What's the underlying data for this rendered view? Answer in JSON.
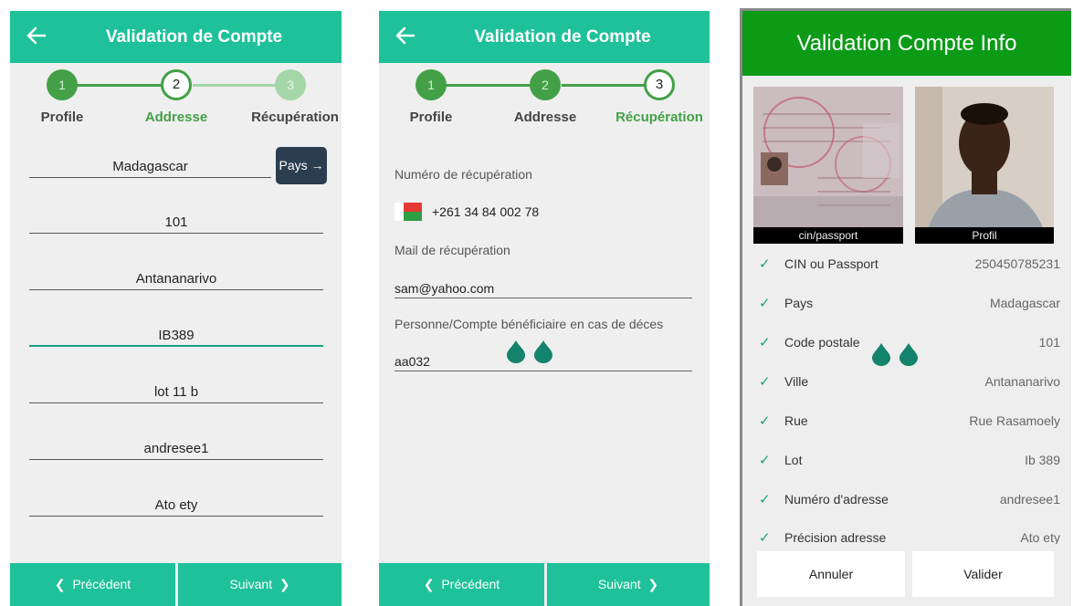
{
  "screen1": {
    "title": "Validation de Compte",
    "steps": [
      {
        "number": "1",
        "label": "Profile"
      },
      {
        "number": "2",
        "label": "Addresse"
      },
      {
        "number": "3",
        "label": "Récupération"
      }
    ],
    "country_value": "Madagascar",
    "pays_button": "Pays",
    "fields": [
      "101",
      "Antananarivo",
      "IB389",
      "lot 11 b",
      "andresee1",
      "Ato ety"
    ],
    "prev_label": "Précédent",
    "next_label": "Suivant"
  },
  "screen2": {
    "title": "Validation de Compte",
    "steps": [
      {
        "number": "1",
        "label": "Profile"
      },
      {
        "number": "2",
        "label": "Addresse"
      },
      {
        "number": "3",
        "label": "Récupération"
      }
    ],
    "phone_label": "Numéro de récupération",
    "phone_value": "+261 34 84 002 78",
    "mail_label": "Mail de récupération",
    "mail_value": "sam@yahoo.com",
    "beneficiary_label": "Personne/Compte bénéficiaire en cas de déces",
    "beneficiary_value": "aa032",
    "prev_label": "Précédent",
    "next_label": "Suivant"
  },
  "screen3": {
    "title": "Validation Compte Info",
    "photo_id_caption": "cin/passport",
    "photo_profile_caption": "Profil",
    "rows": [
      {
        "key": "CIN ou Passport",
        "value": "250450785231"
      },
      {
        "key": "Pays",
        "value": "Madagascar"
      },
      {
        "key": "Code postale",
        "value": "101"
      },
      {
        "key": "Ville",
        "value": "Antananarivo"
      },
      {
        "key": "Rue",
        "value": "Rue Rasamoely"
      },
      {
        "key": "Lot",
        "value": "Ib 389"
      },
      {
        "key": "Numéro d'adresse",
        "value": "andresee1"
      },
      {
        "key": "Précision adresse",
        "value": "Ato ety"
      }
    ],
    "cancel_label": "Annuler",
    "validate_label": "Valider"
  },
  "colors": {
    "appbar": "#1ec19a",
    "step_green": "#43a047",
    "header_green": "#0c9b17",
    "pays_button": "#2b3e50"
  }
}
